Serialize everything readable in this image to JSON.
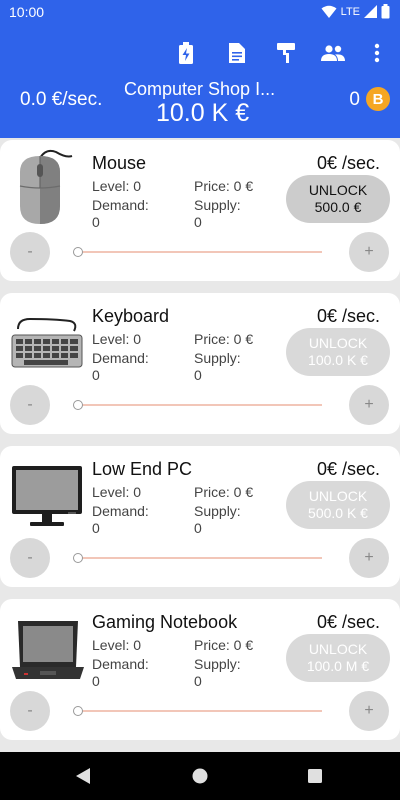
{
  "status": {
    "time": "10:00",
    "network": "LTE"
  },
  "toolbar": {
    "icons": [
      "battery-charging-icon",
      "document-icon",
      "paint-roller-icon",
      "group-icon",
      "more-vert-icon"
    ]
  },
  "header": {
    "rate": "0.0 €/sec.",
    "shop_name": "Computer Shop I...",
    "money": "10.0 K €",
    "coins": "0",
    "coin_symbol": "B"
  },
  "labels": {
    "decrement": "-",
    "increment": "+"
  },
  "products": [
    {
      "name": "Mouse",
      "per_sec": "0€ /sec.",
      "level": "Level: 0",
      "price": "Price: 0 €",
      "demand_label": "Demand:",
      "demand_value": "0",
      "supply_label": "Supply:",
      "supply_value": "0",
      "unlock_label": "UNLOCK",
      "unlock_cost": "500.0 €",
      "unlock_enabled": true,
      "slider": 0
    },
    {
      "name": "Keyboard",
      "per_sec": "0€ /sec.",
      "level": "Level: 0",
      "price": "Price: 0 €",
      "demand_label": "Demand:",
      "demand_value": "0",
      "supply_label": "Supply:",
      "supply_value": "0",
      "unlock_label": "UNLOCK",
      "unlock_cost": "100.0 K €",
      "unlock_enabled": false,
      "slider": 0
    },
    {
      "name": "Low End PC",
      "per_sec": "0€ /sec.",
      "level": "Level: 0",
      "price": "Price: 0 €",
      "demand_label": "Demand:",
      "demand_value": "0",
      "supply_label": "Supply:",
      "supply_value": "0",
      "unlock_label": "UNLOCK",
      "unlock_cost": "500.0 K €",
      "unlock_enabled": false,
      "slider": 0
    },
    {
      "name": "Gaming Notebook",
      "per_sec": "0€ /sec.",
      "level": "Level: 0",
      "price": "Price: 0 €",
      "demand_label": "Demand:",
      "demand_value": "0",
      "supply_label": "Supply:",
      "supply_value": "0",
      "unlock_label": "UNLOCK",
      "unlock_cost": "100.0 M €",
      "unlock_enabled": false,
      "slider": 0
    }
  ]
}
